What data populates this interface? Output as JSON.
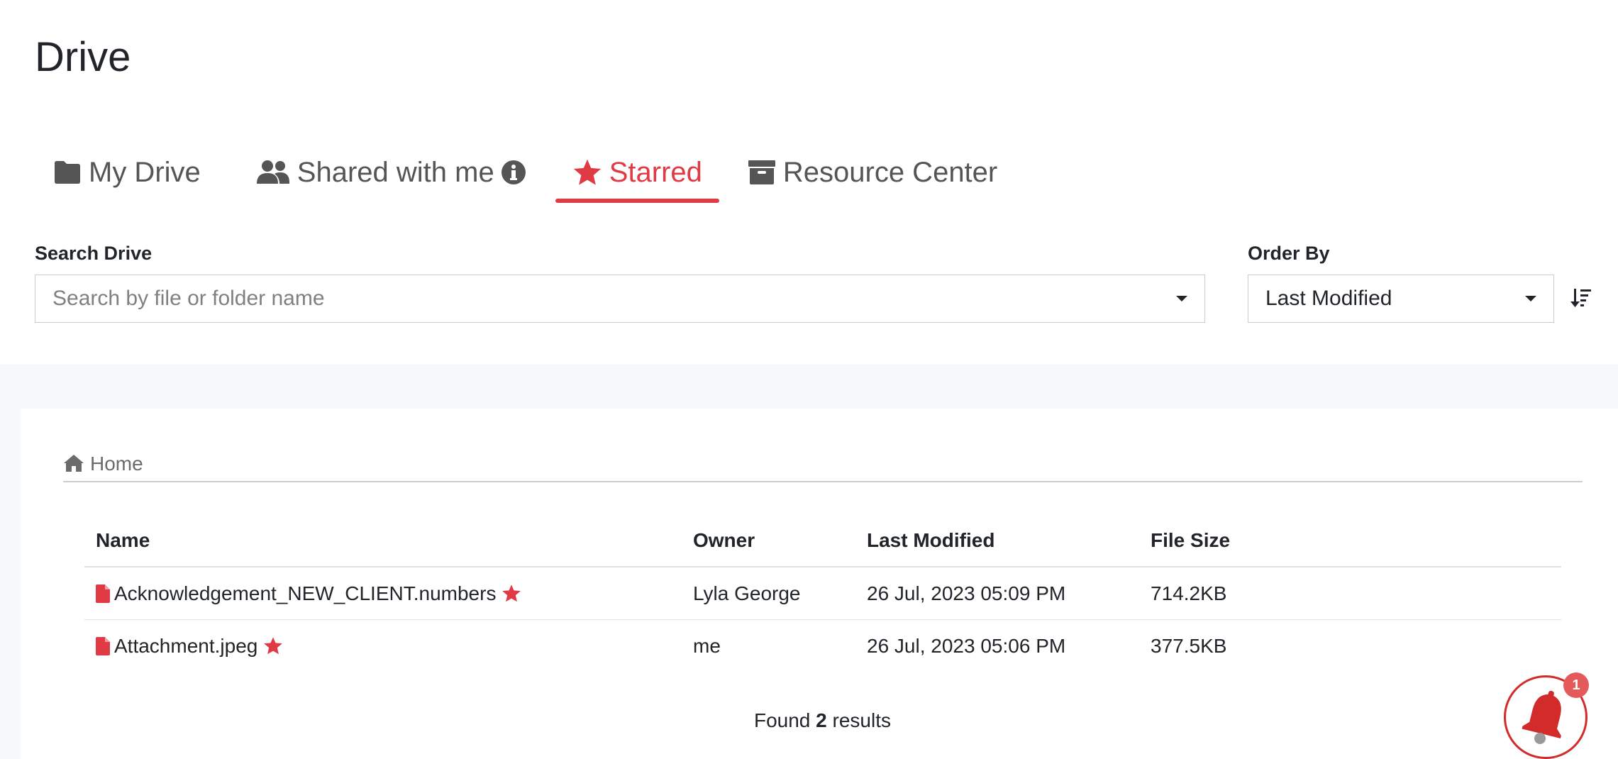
{
  "page": {
    "title": "Drive"
  },
  "tabs": [
    {
      "label": "My Drive",
      "icon": "folder-icon",
      "active": false
    },
    {
      "label": "Shared with me",
      "icon": "users-icon",
      "active": false
    },
    {
      "label": "Starred",
      "icon": "star-icon",
      "active": true
    },
    {
      "label": "Resource Center",
      "icon": "archive-icon",
      "active": false
    }
  ],
  "search": {
    "label": "Search Drive",
    "placeholder": "Search by file or folder name",
    "value": ""
  },
  "order": {
    "label": "Order By",
    "selected": "Last Modified"
  },
  "breadcrumb": {
    "home_label": "Home"
  },
  "table": {
    "headers": {
      "name": "Name",
      "owner": "Owner",
      "last_modified": "Last Modified",
      "file_size": "File Size"
    },
    "rows": [
      {
        "name": "Acknowledgement_NEW_CLIENT.numbers",
        "owner": "Lyla George",
        "last_modified": "26 Jul, 2023 05:09 PM",
        "file_size": "714.2KB",
        "starred": true
      },
      {
        "name": "Attachment.jpeg",
        "owner": "me",
        "last_modified": "26 Jul, 2023 05:06 PM",
        "file_size": "377.5KB",
        "starred": true
      }
    ]
  },
  "results": {
    "prefix": "Found",
    "count": "2",
    "suffix": "results"
  },
  "notifications": {
    "badge_count": "1"
  },
  "colors": {
    "accent": "#e03a45",
    "text": "#212529",
    "muted": "#555555",
    "band": "#f7f8fc"
  }
}
